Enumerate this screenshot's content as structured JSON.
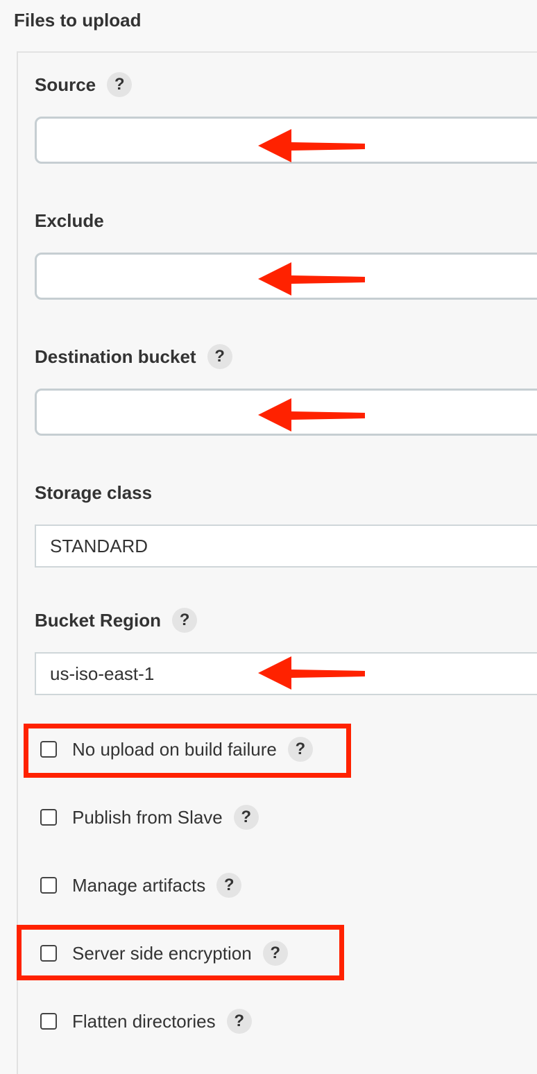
{
  "section_title": "Files to upload",
  "fields": {
    "source": {
      "label": "Source",
      "value": "",
      "help": "?"
    },
    "exclude": {
      "label": "Exclude",
      "value": ""
    },
    "destination_bucket": {
      "label": "Destination bucket",
      "value": "",
      "help": "?"
    },
    "storage_class": {
      "label": "Storage class",
      "value": "STANDARD"
    },
    "bucket_region": {
      "label": "Bucket Region",
      "value": "us-iso-east-1",
      "help": "?"
    }
  },
  "checkboxes": [
    {
      "label": "No upload on build failure",
      "checked": false,
      "help": "?",
      "highlighted": true
    },
    {
      "label": "Publish from Slave",
      "checked": false,
      "help": "?",
      "highlighted": false
    },
    {
      "label": "Manage artifacts",
      "checked": false,
      "help": "?",
      "highlighted": false
    },
    {
      "label": "Server side encryption",
      "checked": false,
      "help": "?",
      "highlighted": true
    },
    {
      "label": "Flatten directories",
      "checked": false,
      "help": "?",
      "highlighted": false
    }
  ],
  "colors": {
    "annotation": "#ff2200",
    "panel_background": "#f7f7f7",
    "input_border": "#c6ced2"
  }
}
